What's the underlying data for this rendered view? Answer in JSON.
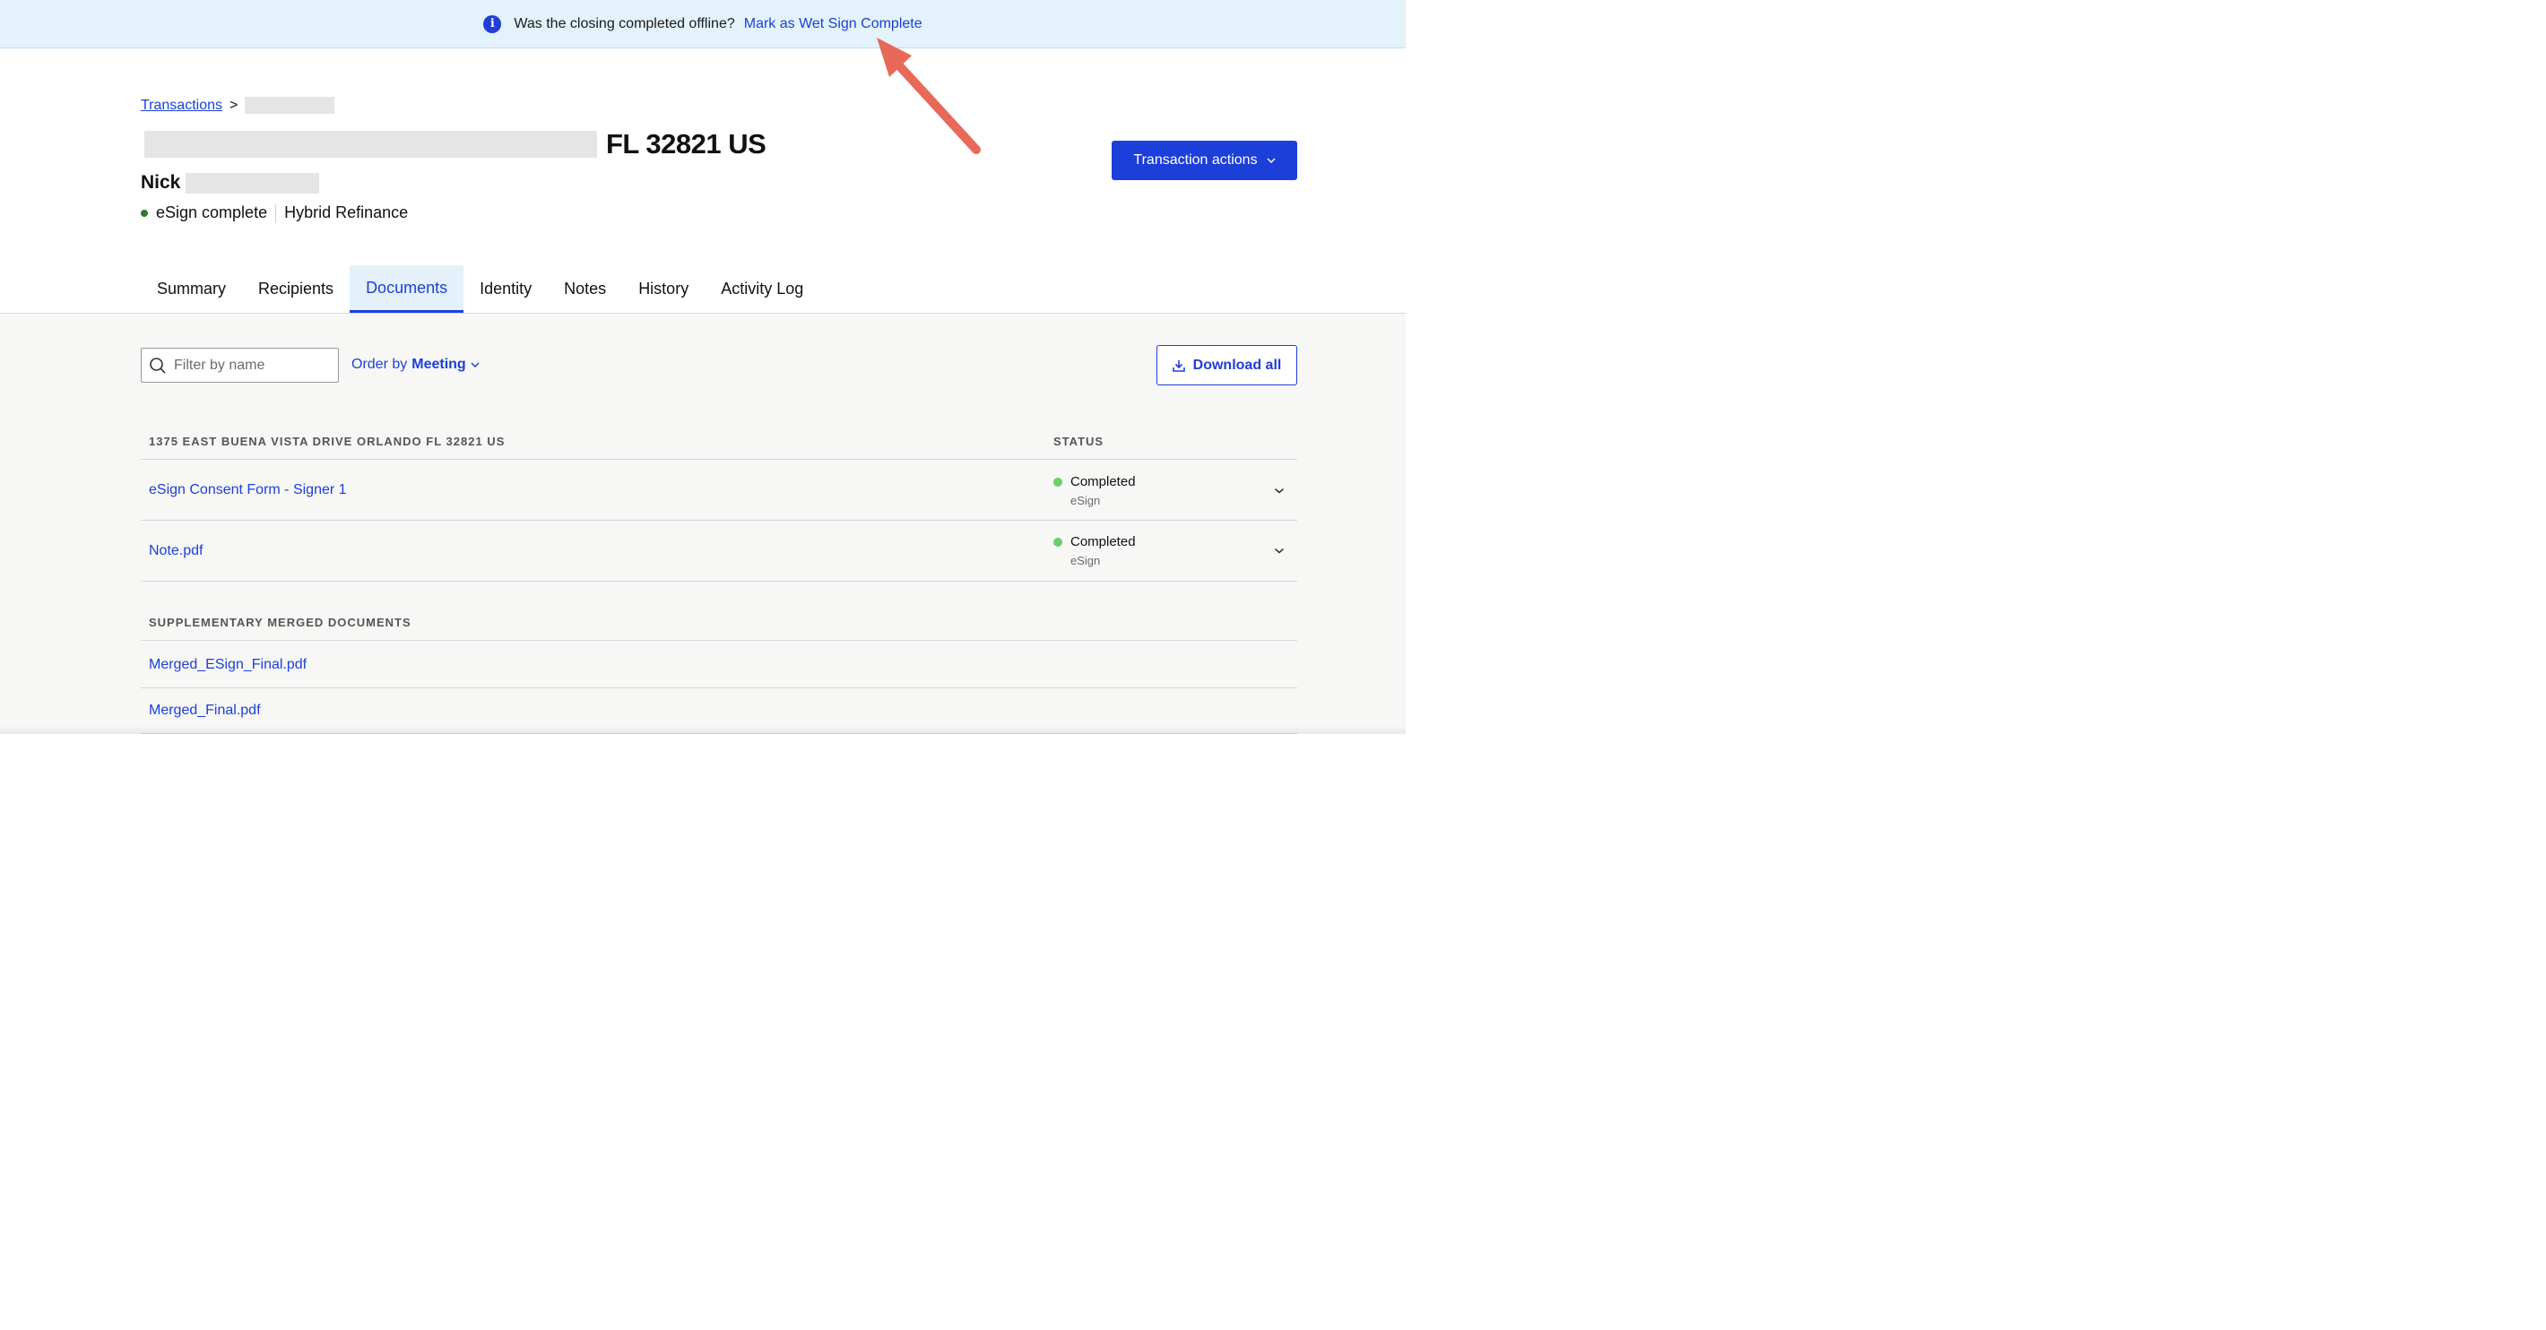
{
  "banner": {
    "question": "Was the closing completed offline?",
    "link": "Mark as Wet Sign Complete"
  },
  "breadcrumb": {
    "root": "Transactions",
    "separator": ">"
  },
  "transaction": {
    "title_suffix": "FL 32821 US",
    "signer_first_name": "Nick",
    "status": "eSign complete",
    "type": "Hybrid Refinance",
    "actions_label": "Transaction actions"
  },
  "tabs": [
    {
      "label": "Summary"
    },
    {
      "label": "Recipients"
    },
    {
      "label": "Documents"
    },
    {
      "label": "Identity"
    },
    {
      "label": "Notes"
    },
    {
      "label": "History"
    },
    {
      "label": "Activity Log"
    }
  ],
  "active_tab": "Documents",
  "toolbar": {
    "filter_placeholder": "Filter by name",
    "order_prefix": "Order by",
    "order_value": "Meeting",
    "download_label": "Download all"
  },
  "sections": [
    {
      "heading": "1375 EAST BUENA VISTA DRIVE ORLANDO FL 32821 US",
      "status_heading": "STATUS",
      "documents": [
        {
          "name": "eSign Consent Form - Signer 1",
          "status": "Completed",
          "method": "eSign"
        },
        {
          "name": "Note.pdf",
          "status": "Completed",
          "method": "eSign"
        }
      ]
    },
    {
      "heading": "SUPPLEMENTARY MERGED DOCUMENTS",
      "documents": [
        {
          "name": "Merged_ESign_Final.pdf"
        },
        {
          "name": "Merged_Final.pdf"
        }
      ]
    }
  ],
  "colors": {
    "accent": "#1c3fd9",
    "banner_bg": "#e3f2fb",
    "status_complete": "#6ccf6c",
    "annotation_arrow": "#e8695a"
  }
}
